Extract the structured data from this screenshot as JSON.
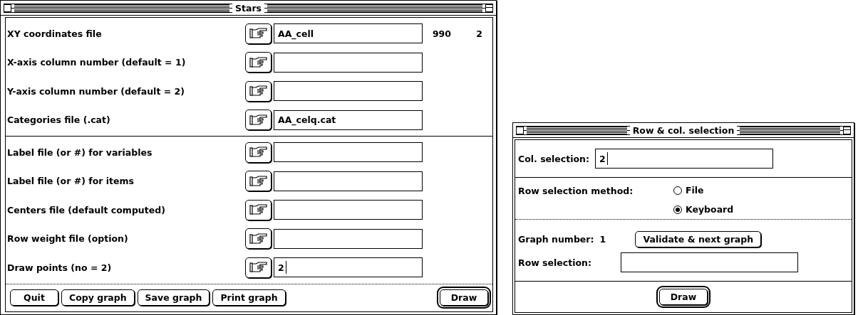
{
  "stars_window": {
    "title": "Stars",
    "groups": [
      {
        "rows": [
          {
            "label": "XY coordinates file",
            "value": "AA_cell",
            "extras": [
              "990",
              "2"
            ]
          },
          {
            "label": "X-axis column number (default = 1)"
          },
          {
            "label": "Y-axis column number (default = 2)"
          },
          {
            "label": "Categories file (.cat)",
            "value": "AA_celq.cat"
          }
        ]
      },
      {
        "rows": [
          {
            "label": "Label file (or #) for variables"
          },
          {
            "label": "Label file (or #) for items"
          },
          {
            "label": "Centers file (default computed)"
          },
          {
            "label": "Row weight file (option)"
          },
          {
            "label": "Draw points (no = 2)",
            "value": "2",
            "cursor": true
          }
        ]
      }
    ],
    "buttons": [
      {
        "label": "Quit",
        "default": false
      },
      {
        "label": "Copy graph",
        "default": false
      },
      {
        "label": "Save graph",
        "default": false
      },
      {
        "label": "Print graph",
        "default": false
      },
      {
        "label": "Draw",
        "default": true
      }
    ]
  },
  "selection_window": {
    "title": "Row & col. selection",
    "col_selection": {
      "label": "Col. selection:",
      "value": "2",
      "cursor": true
    },
    "row_method": {
      "label": "Row selection method:",
      "options": [
        {
          "label": "File",
          "selected": false
        },
        {
          "label": "Keyboard",
          "selected": true
        }
      ]
    },
    "graph_number": {
      "label": "Graph number:",
      "value": "1"
    },
    "next_button": {
      "label": "Validate & next graph",
      "default": false
    },
    "row_selection": {
      "label": "Row selection:"
    },
    "draw_button": {
      "label": "Draw",
      "default": true
    }
  }
}
